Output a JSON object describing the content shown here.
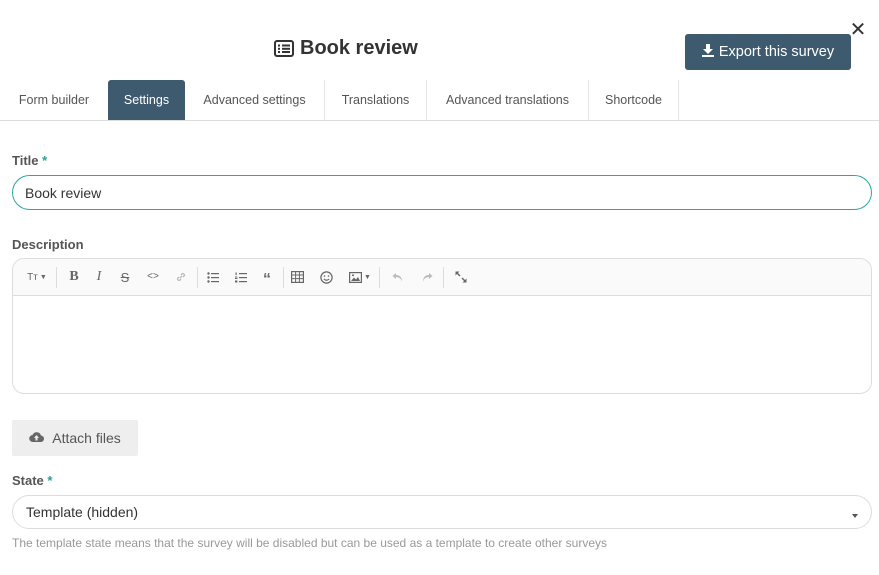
{
  "header": {
    "title": "Book review",
    "title_icon": "list-alt-icon",
    "export_label": "Export this survey",
    "export_icon": "download-icon",
    "close_icon": "close-icon"
  },
  "tabs": [
    {
      "label": "Form builder",
      "active": false
    },
    {
      "label": "Settings",
      "active": true
    },
    {
      "label": "Advanced settings",
      "active": false
    },
    {
      "label": "Translations",
      "active": false
    },
    {
      "label": "Advanced translations",
      "active": false
    },
    {
      "label": "Shortcode",
      "active": false
    }
  ],
  "form": {
    "title_label": "Title",
    "title_value": "Book review",
    "description_label": "Description",
    "required_mark": "*",
    "attach_label": "Attach files",
    "attach_icon": "cloud-upload-icon",
    "state_label": "State",
    "state_value": "Template (hidden)",
    "state_help": "The template state means that the survey will be disabled but can be used as a template to create other surveys"
  },
  "toolbar": {
    "heading_glyph": "Tт",
    "items": [
      "heading-icon",
      "bold-icon",
      "italic-icon",
      "strikethrough-icon",
      "code-icon",
      "link-icon",
      "bullet-list-icon",
      "numbered-list-icon",
      "quote-icon",
      "table-icon",
      "emoji-icon",
      "image-icon",
      "undo-icon",
      "redo-icon",
      "fullscreen-icon"
    ]
  },
  "colors": {
    "primary": "#3d5a6e",
    "accent": "#2aa7a2",
    "muted_text": "#999999"
  }
}
